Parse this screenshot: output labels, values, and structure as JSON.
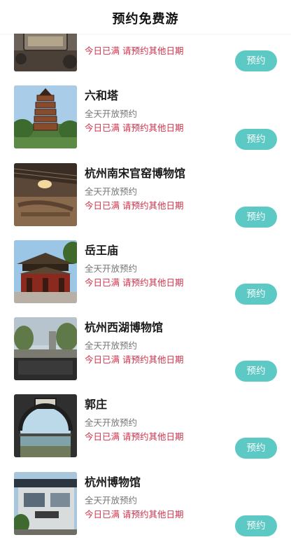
{
  "header": {
    "title": "预约免费游"
  },
  "colors": {
    "accent": "#5cc9c5",
    "status": "#d0334c"
  },
  "venues": [
    {
      "name": "",
      "hours": "",
      "status": "今日已满 请预约其他日期",
      "book_label": "预约",
      "thumb": "sign-board"
    },
    {
      "name": "六和塔",
      "hours": "全天开放预约",
      "status": "今日已满 请预约其他日期",
      "book_label": "预约",
      "thumb": "pagoda"
    },
    {
      "name": "杭州南宋官窑博物馆",
      "hours": "全天开放预约",
      "status": "今日已满 请预约其他日期",
      "book_label": "预约",
      "thumb": "kiln-hall"
    },
    {
      "name": "岳王庙",
      "hours": "全天开放预约",
      "status": "今日已满 请预约其他日期",
      "book_label": "预约",
      "thumb": "temple"
    },
    {
      "name": "杭州西湖博物馆",
      "hours": "全天开放预约",
      "status": "今日已满 请预约其他日期",
      "book_label": "预约",
      "thumb": "museum-sign"
    },
    {
      "name": "郭庄",
      "hours": "全天开放预约",
      "status": "今日已满 请预约其他日期",
      "book_label": "预约",
      "thumb": "moon-gate"
    },
    {
      "name": "杭州博物馆",
      "hours": "全天开放预约",
      "status": "今日已满 请预约其他日期",
      "book_label": "预约",
      "thumb": "modern-building"
    }
  ]
}
